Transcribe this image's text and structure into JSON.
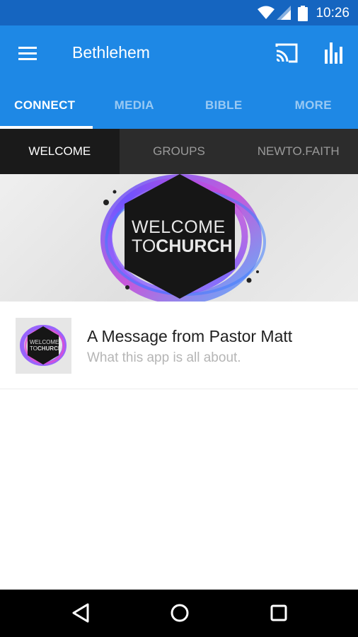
{
  "status_bar": {
    "time": "10:26",
    "icons": [
      "wifi-icon",
      "cell-signal-icon",
      "battery-icon"
    ]
  },
  "app_bar": {
    "title": "Bethlehem",
    "icons": [
      "menu-icon",
      "cast-icon",
      "stats-icon"
    ]
  },
  "tabs": [
    {
      "label": "CONNECT",
      "active": true
    },
    {
      "label": "MEDIA",
      "active": false
    },
    {
      "label": "BIBLE",
      "active": false
    },
    {
      "label": "MORE",
      "active": false
    }
  ],
  "subtabs": [
    {
      "label": "WELCOME",
      "active": true
    },
    {
      "label": "GROUPS",
      "active": false
    },
    {
      "label": "NEWTO.FAITH",
      "active": false
    }
  ],
  "banner": {
    "line1": "WELCOME",
    "line2_a": "TO",
    "line2_b": "CHURCH"
  },
  "list": [
    {
      "title": "A Message from Pastor Matt",
      "subtitle": "What this app is all about.",
      "thumb_line1": "WELCOME",
      "thumb_line2_a": "TO",
      "thumb_line2_b": "CHURCH"
    }
  ],
  "colors": {
    "status_bar": "#1565c0",
    "app_bar": "#1e88e5",
    "subtabs_bg": "#2c2c2c",
    "subtab_active_bg": "#1a1a1a"
  },
  "nav_bar": {
    "icons": [
      "back-icon",
      "home-icon",
      "recents-icon"
    ]
  }
}
